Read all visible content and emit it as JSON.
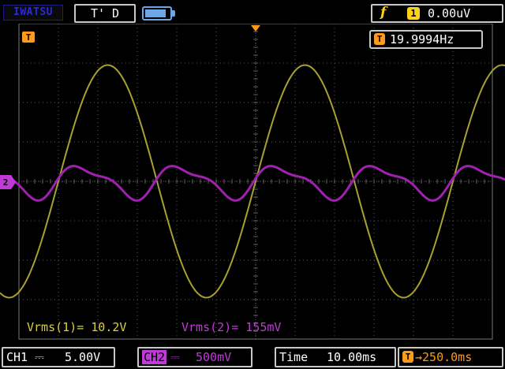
{
  "header": {
    "brand": "IWATSU",
    "mode": "T' D",
    "battery_level": 0.85,
    "trigger": {
      "edge_icon": "rising-edge-icon",
      "edge_glyph": "f",
      "source": "1",
      "level": "0.00uV"
    }
  },
  "screen": {
    "trigger_marker": "T",
    "ch2_marker": "2",
    "frequency": {
      "icon": "T",
      "value": "19.9994Hz"
    }
  },
  "measurements": {
    "ch1": "Vrms(1)= 10.2V",
    "ch2": "Vrms(2)= 155mV"
  },
  "bottom": {
    "ch1": {
      "label": "CH1",
      "coupling": "⎓",
      "scale": "5.00V"
    },
    "ch2": {
      "label": "CH2",
      "coupling": "⎓",
      "scale": "500mV"
    },
    "timebase": {
      "label": "Time",
      "value": "10.00ms"
    },
    "trigger_pos": {
      "icon": "T",
      "value": "→250.0ms"
    }
  },
  "colors": {
    "ch1": "#a8a030",
    "ch2": "#a020b0",
    "grid": "#5a5a5a",
    "trigger": "#ff9a1a",
    "accent": "#ffd21a"
  },
  "waveforms": {
    "ch1": {
      "frequency_hz": 20,
      "amplitude_div": 2.95
    },
    "ch2": {
      "frequency_hz": 40,
      "amplitude_div": 0.38,
      "harmonic_ratio": 0.35
    }
  }
}
